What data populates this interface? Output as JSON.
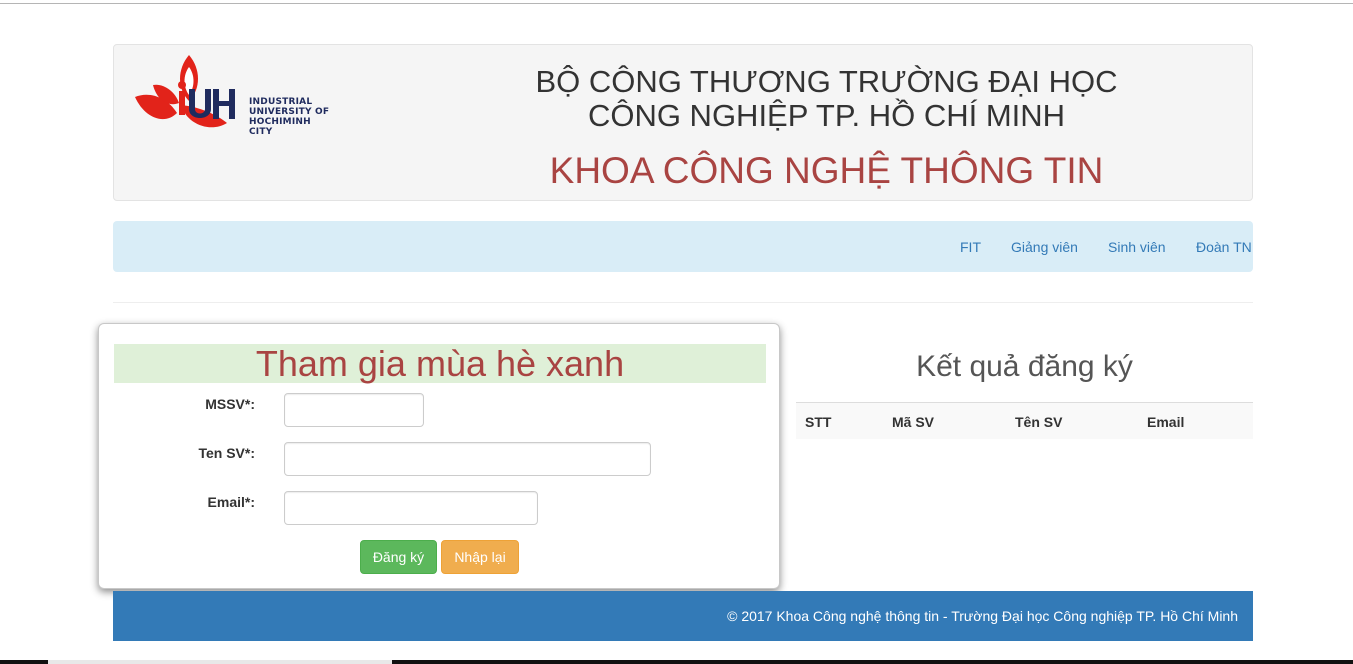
{
  "header": {
    "logo_lines": [
      "INDUSTRIAL",
      "UNIVERSITY OF",
      "HOCHIMINH CITY"
    ],
    "logo_letters": "iUH",
    "title_line1": "BỘ CÔNG THƯƠNG TRƯỜNG ĐẠI HỌC",
    "title_line2": "CÔNG NGHIỆP TP. HỒ CHÍ MINH",
    "faculty": "KHOA CÔNG NGHỆ THÔNG TIN"
  },
  "nav": {
    "items": [
      {
        "label": "FIT"
      },
      {
        "label": "Giảng viên"
      },
      {
        "label": "Sinh viên"
      },
      {
        "label": "Đoàn TN"
      }
    ]
  },
  "form": {
    "title": "Tham gia mùa hè xanh",
    "fields": [
      {
        "label": "MSSV*:",
        "value": ""
      },
      {
        "label": "Ten SV*:",
        "value": ""
      },
      {
        "label": "Email*:",
        "value": ""
      }
    ],
    "submit_label": "Đăng ký",
    "reset_label": "Nhập lại"
  },
  "results": {
    "title": "Kết quả đăng ký",
    "columns": [
      "STT",
      "Mã SV",
      "Tên SV",
      "Email"
    ],
    "rows": []
  },
  "footer": {
    "text": "© 2017 Khoa Công nghệ thông tin - Trường Đại học Công nghiệp TP. Hồ Chí Minh"
  },
  "colors": {
    "accent_red": "#a94442",
    "nav_bg": "#d9edf7",
    "link": "#337ab7",
    "footer_bg": "#337ab7",
    "success": "#5cb85c",
    "warning": "#f0ad4e"
  }
}
